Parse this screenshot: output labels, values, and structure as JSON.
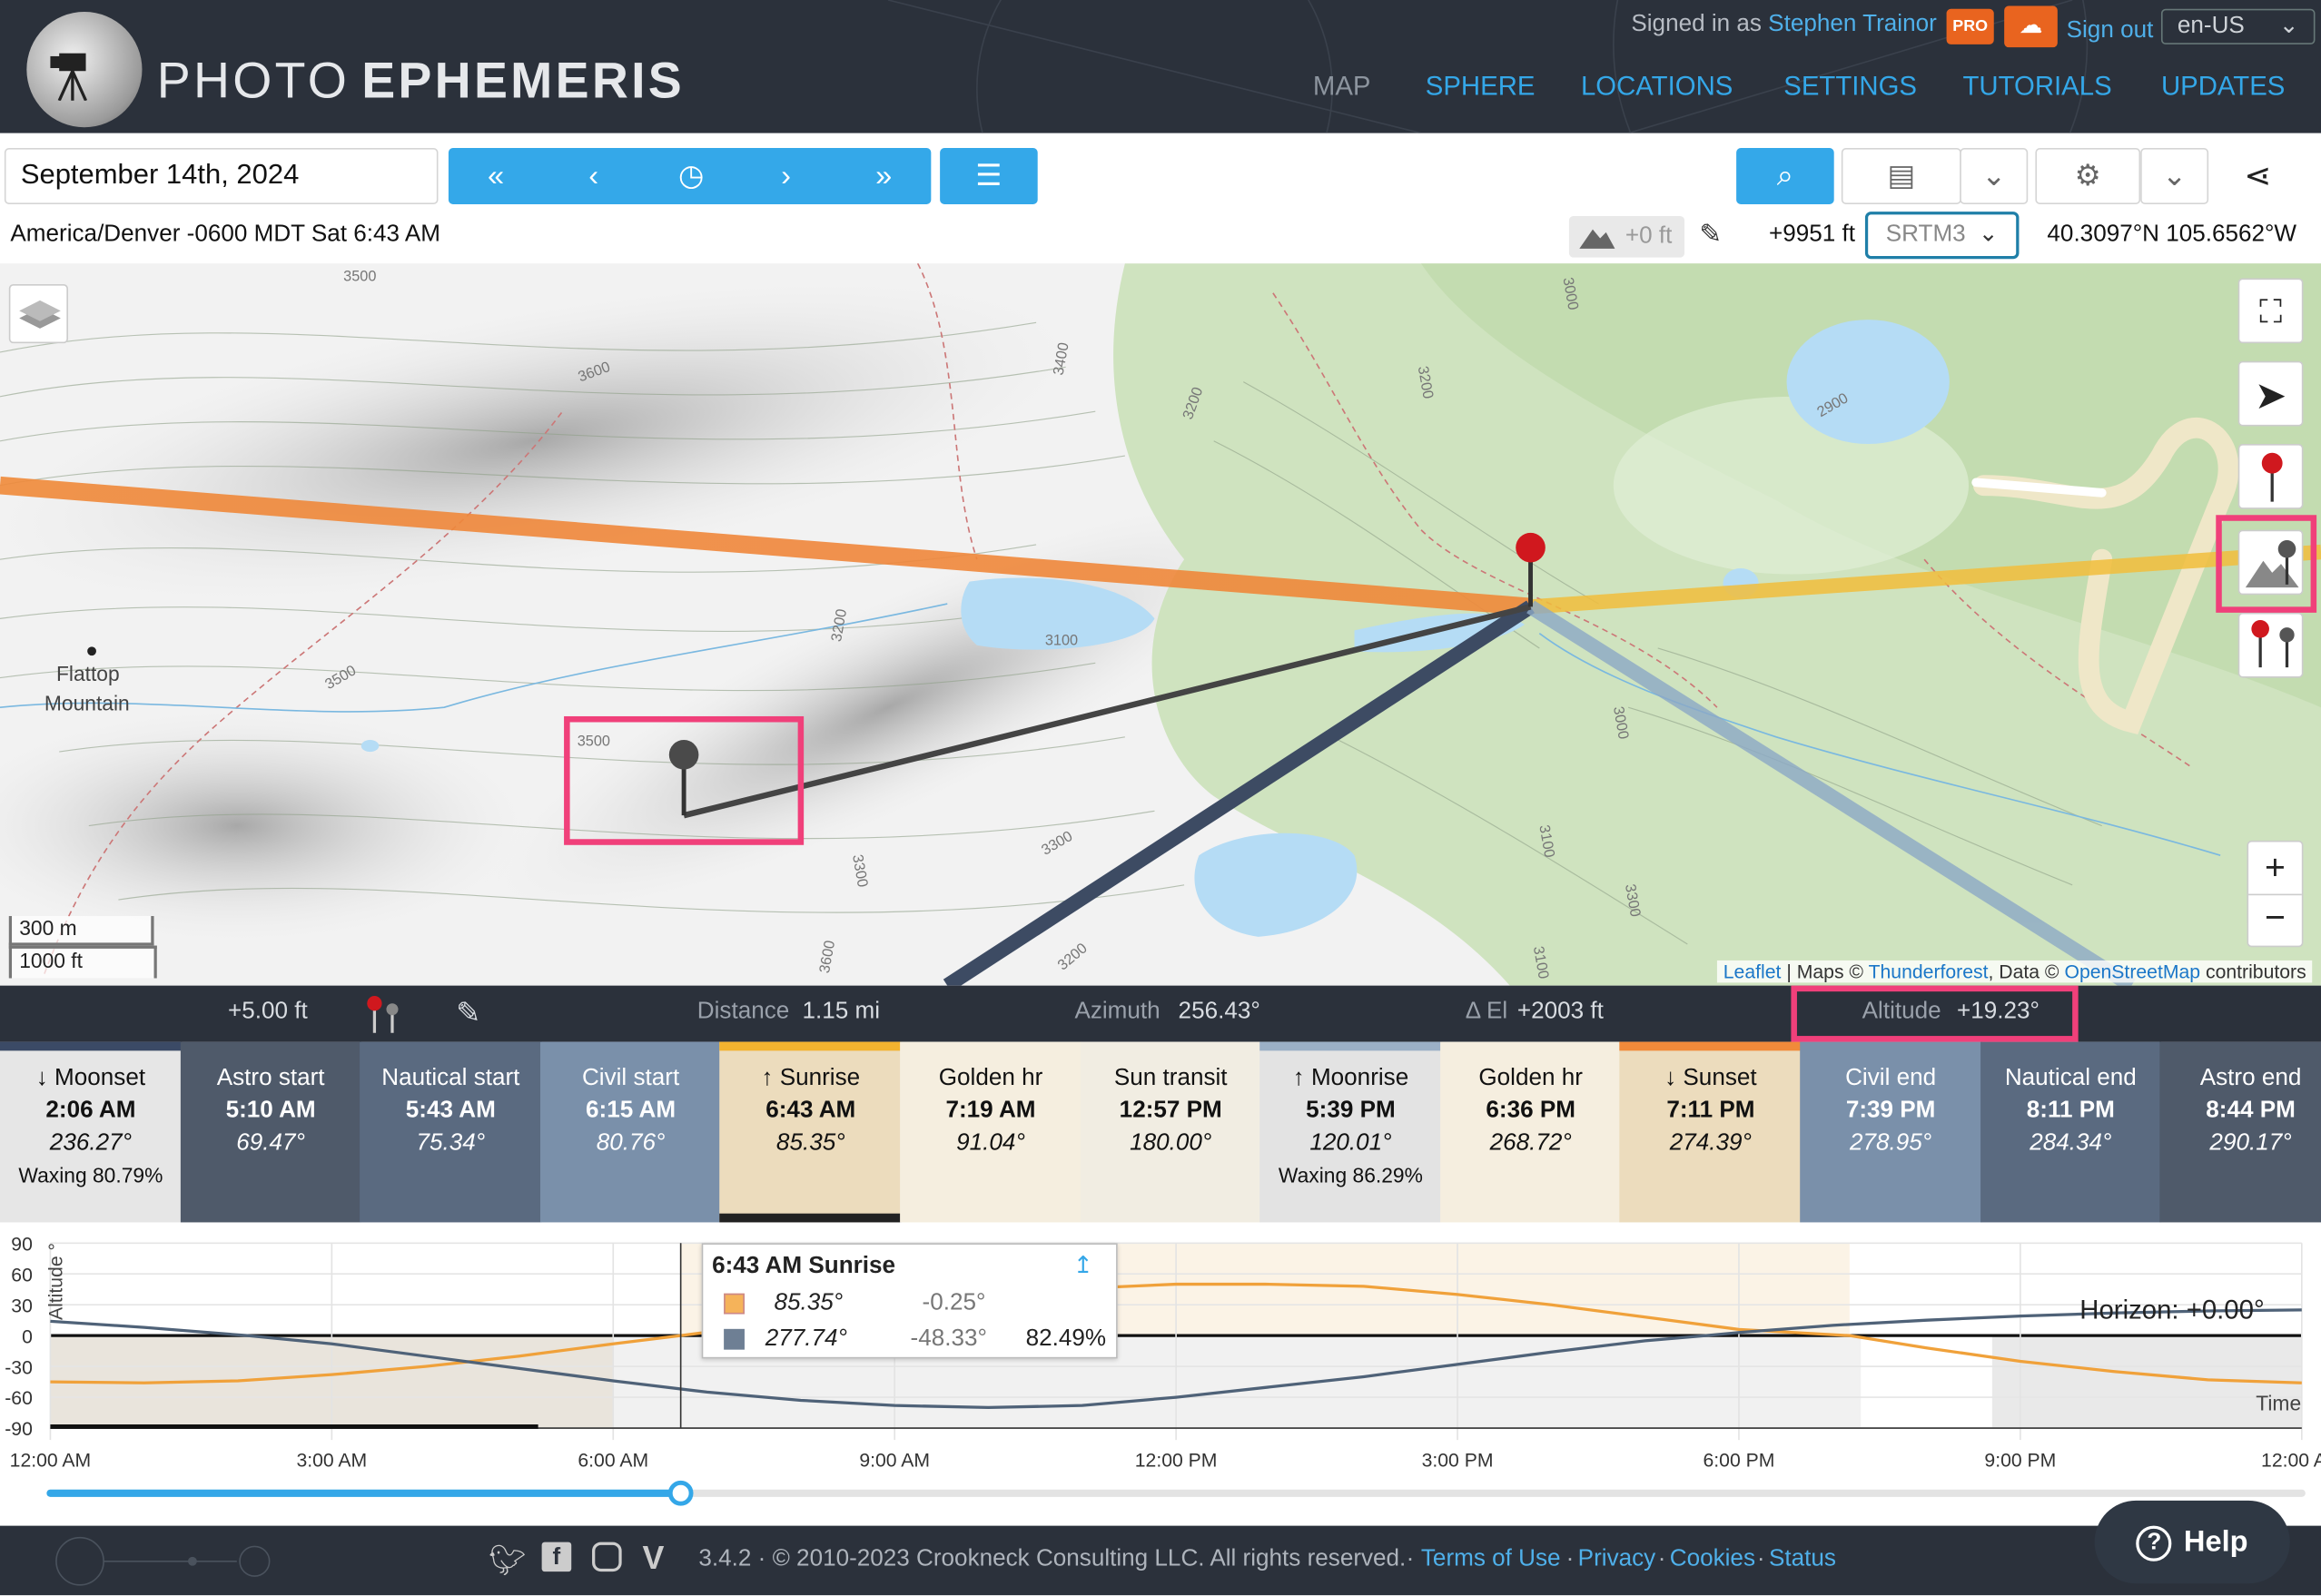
{
  "header": {
    "brand_light": "PHOTO",
    "brand_bold": "EPHEMERIS",
    "signed_in_prefix": "Signed in as",
    "user": "Stephen Trainor",
    "pro_badge": "PRO",
    "sign_out": "Sign out",
    "language": "en-US",
    "nav": [
      "MAP",
      "SPHERE",
      "LOCATIONS",
      "SETTINGS",
      "TUTORIALS",
      "UPDATES"
    ]
  },
  "toolbar": {
    "date": "September 14th, 2024",
    "timezone_line": "America/Denver -0600 MDT Sat 6:43 AM",
    "height_offset": "+0 ft",
    "elevation": "+9951 ft",
    "dem": "SRTM3",
    "coordinates": "40.3097°N 105.6562°W"
  },
  "map": {
    "scale_m": "300 m",
    "scale_ft": "1000 ft",
    "place": "Flattop Mountain",
    "attribution": {
      "leaflet": "Leaflet",
      "maps": "| Maps ©",
      "thunderforest": "Thunderforest",
      "data": ", Data ©",
      "osm": "OpenStreetMap",
      "contributors": "contributors"
    },
    "contour_labels": [
      "3500",
      "3600",
      "3500",
      "3600",
      "3200",
      "3400",
      "3300",
      "3200",
      "3100",
      "3000",
      "3100",
      "3000",
      "3200",
      "2900",
      "3500",
      "3300",
      "3100",
      "3300",
      "3200"
    ]
  },
  "infobar": {
    "height": "+5.00 ft",
    "distance_label": "Distance",
    "distance": "1.15 mi",
    "azimuth_label": "Azimuth",
    "azimuth": "256.43°",
    "del_label": "Δ El",
    "del": "+2003 ft",
    "altitude_label": "Altitude",
    "altitude": "+19.23°"
  },
  "events": [
    {
      "name": "↓ Moonset",
      "time": "2:06 AM",
      "az": "236.27°",
      "extra": "Waxing 80.79%"
    },
    {
      "name": "Astro start",
      "time": "5:10 AM",
      "az": "69.47°",
      "extra": ""
    },
    {
      "name": "Nautical start",
      "time": "5:43 AM",
      "az": "75.34°",
      "extra": ""
    },
    {
      "name": "Civil start",
      "time": "6:15 AM",
      "az": "80.76°",
      "extra": ""
    },
    {
      "name": "↑ Sunrise",
      "time": "6:43 AM",
      "az": "85.35°",
      "extra": ""
    },
    {
      "name": "Golden hr",
      "time": "7:19 AM",
      "az": "91.04°",
      "extra": ""
    },
    {
      "name": "Sun transit",
      "time": "12:57 PM",
      "az": "180.00°",
      "extra": ""
    },
    {
      "name": "↑ Moonrise",
      "time": "5:39 PM",
      "az": "120.01°",
      "extra": "Waxing 86.29%"
    },
    {
      "name": "Golden hr",
      "time": "6:36 PM",
      "az": "268.72°",
      "extra": ""
    },
    {
      "name": "↓ Sunset",
      "time": "7:11 PM",
      "az": "274.39°",
      "extra": ""
    },
    {
      "name": "Civil end",
      "time": "7:39 PM",
      "az": "278.95°",
      "extra": ""
    },
    {
      "name": "Nautical end",
      "time": "8:11 PM",
      "az": "284.34°",
      "extra": ""
    },
    {
      "name": "Astro end",
      "time": "8:44 PM",
      "az": "290.17°",
      "extra": ""
    }
  ],
  "chart_data": {
    "type": "line",
    "ylabel": "Altitude °",
    "xlabel": "Time",
    "horizon_label": "Horizon: +0.00°",
    "y_ticks": [
      "90",
      "60",
      "30",
      "0",
      "-30",
      "-60",
      "-90"
    ],
    "ylim": [
      -90,
      90
    ],
    "x_ticks": [
      "12:00 AM",
      "3:00 AM",
      "6:00 AM",
      "9:00 AM",
      "12:00 PM",
      "3:00 PM",
      "6:00 PM",
      "9:00 PM",
      "12:00 AM"
    ],
    "series": [
      {
        "name": "Sun",
        "color": "#f0a13a",
        "x_hours": [
          0,
          1,
          2,
          3,
          4,
          5,
          6,
          6.72,
          8,
          9,
          10,
          11,
          12,
          12.95,
          14,
          15,
          16,
          17,
          18,
          19.18,
          20,
          21,
          22,
          23,
          24
        ],
        "values": [
          -45,
          -46,
          -44,
          -38,
          -30,
          -20,
          -8,
          0,
          15,
          28,
          38,
          46,
          50,
          50,
          48,
          40,
          30,
          18,
          6,
          0,
          -12,
          -25,
          -35,
          -43,
          -46
        ]
      },
      {
        "name": "Moon",
        "color": "#4f6278",
        "x_hours": [
          0,
          1,
          2.1,
          3,
          4,
          5,
          6,
          7,
          8,
          9,
          10,
          11,
          12,
          13,
          14,
          15,
          16,
          17,
          17.65,
          18,
          19,
          20,
          21,
          22,
          23,
          24
        ],
        "values": [
          14,
          8,
          0,
          -8,
          -20,
          -32,
          -44,
          -55,
          -63,
          -68,
          -70,
          -68,
          -60,
          -50,
          -40,
          -28,
          -16,
          -5,
          0,
          3,
          10,
          15,
          19,
          22,
          24,
          25
        ]
      }
    ],
    "tooltip": {
      "title": "6:43 AM Sunrise",
      "sun_az": "85.35°",
      "sun_alt": "-0.25°",
      "moon_az": "277.74°",
      "moon_alt": "-48.33°",
      "moon_illum": "82.49%"
    },
    "current_time_hours": 6.72
  },
  "footer": {
    "version": "3.4.2 · © 2010-2023 Crookneck Consulting LLC. All rights reserved.",
    "terms": "Terms of Use",
    "privacy": "Privacy",
    "cookies": "Cookies",
    "status": "Status",
    "sep": "·",
    "help": "Help"
  }
}
